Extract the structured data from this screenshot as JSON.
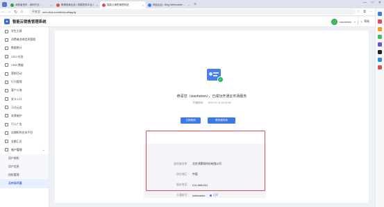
{
  "browser": {
    "tabs": [
      {
        "title": "消费者资讯 - 深圳行业 ...",
        "active": false,
        "color": "#2f9c5a"
      },
      {
        "title": "微博独家出品 | 视频发布平台 | ...",
        "active": false,
        "color": "#d9534f"
      },
      {
        "title": "智能云销售管理系统",
        "active": true,
        "color": "#d9534f"
      },
      {
        "title": "网站后台 - Bing Webmaster ...",
        "active": false,
        "color": "#3f79e9"
      }
    ],
    "address_warning": "不安全",
    "url": "crm.cfxd.com/#/cloud/apply",
    "icons": [
      "profile-icon",
      "back-icon",
      "forward-icon",
      "reload-icon",
      "home-icon",
      "star-icon",
      "extensions-icon",
      "menu-icon"
    ]
  },
  "header": {
    "app_title": "智能云销售管理系统",
    "username": "xiaohelren",
    "help": "帮助"
  },
  "sidebar": {
    "items": [
      {
        "label": "学生大屏",
        "icon": "dashboard-icon"
      },
      {
        "label": "消费者咨询信息管理",
        "icon": "chat-icon"
      },
      {
        "label": "数据统计",
        "icon": "chart-icon"
      },
      {
        "label": "CRO 任务",
        "icon": "task-icon"
      },
      {
        "label": "CRM 数据",
        "icon": "database-icon"
      },
      {
        "label": "营销活动",
        "icon": "megaphone-icon"
      },
      {
        "label": "行为管理",
        "icon": "behavior-icon"
      },
      {
        "label": "客户公海",
        "icon": "users-icon"
      },
      {
        "label": "发卡入口",
        "icon": "card-icon"
      },
      {
        "label": "万达云店",
        "icon": "store-icon"
      },
      {
        "label": "发票维护",
        "icon": "invoice-icon"
      },
      {
        "label": "引入广告",
        "icon": "ad-icon"
      },
      {
        "label": "店铺机构业务平台",
        "icon": "org-icon"
      },
      {
        "label": "金额汇总",
        "icon": "money-icon"
      },
      {
        "label": "账户管理",
        "icon": "account-icon",
        "open": true
      }
    ],
    "sub_items": [
      {
        "label": "用户授权",
        "active": false
      },
      {
        "label": "用户信息",
        "active": false
      },
      {
        "label": "授权管理",
        "active": false
      },
      {
        "label": "云市场开通",
        "active": true
      }
    ]
  },
  "main": {
    "message": "恭喜您（xiaohelren），已成功开通云市场服务",
    "time_label": "开通时间：",
    "time_value": "2020.07.21 15:31:08",
    "button_primary": "立即使用",
    "button_secondary": "联系服务商",
    "info": {
      "name_label": "服务商名称：",
      "name_value": "北京鸿蒙网科技有限公司",
      "region_label": "所在地区：",
      "region_value": "中国",
      "phone_label": "服务电话：",
      "phone_value": "010-8861331",
      "account_label": "开通账号：",
      "account_value": "webmaster",
      "account_badge": "已开"
    }
  },
  "colors": {
    "accent": "#3f79e9",
    "success": "#1fb765",
    "highlight": "#e24a5c"
  }
}
